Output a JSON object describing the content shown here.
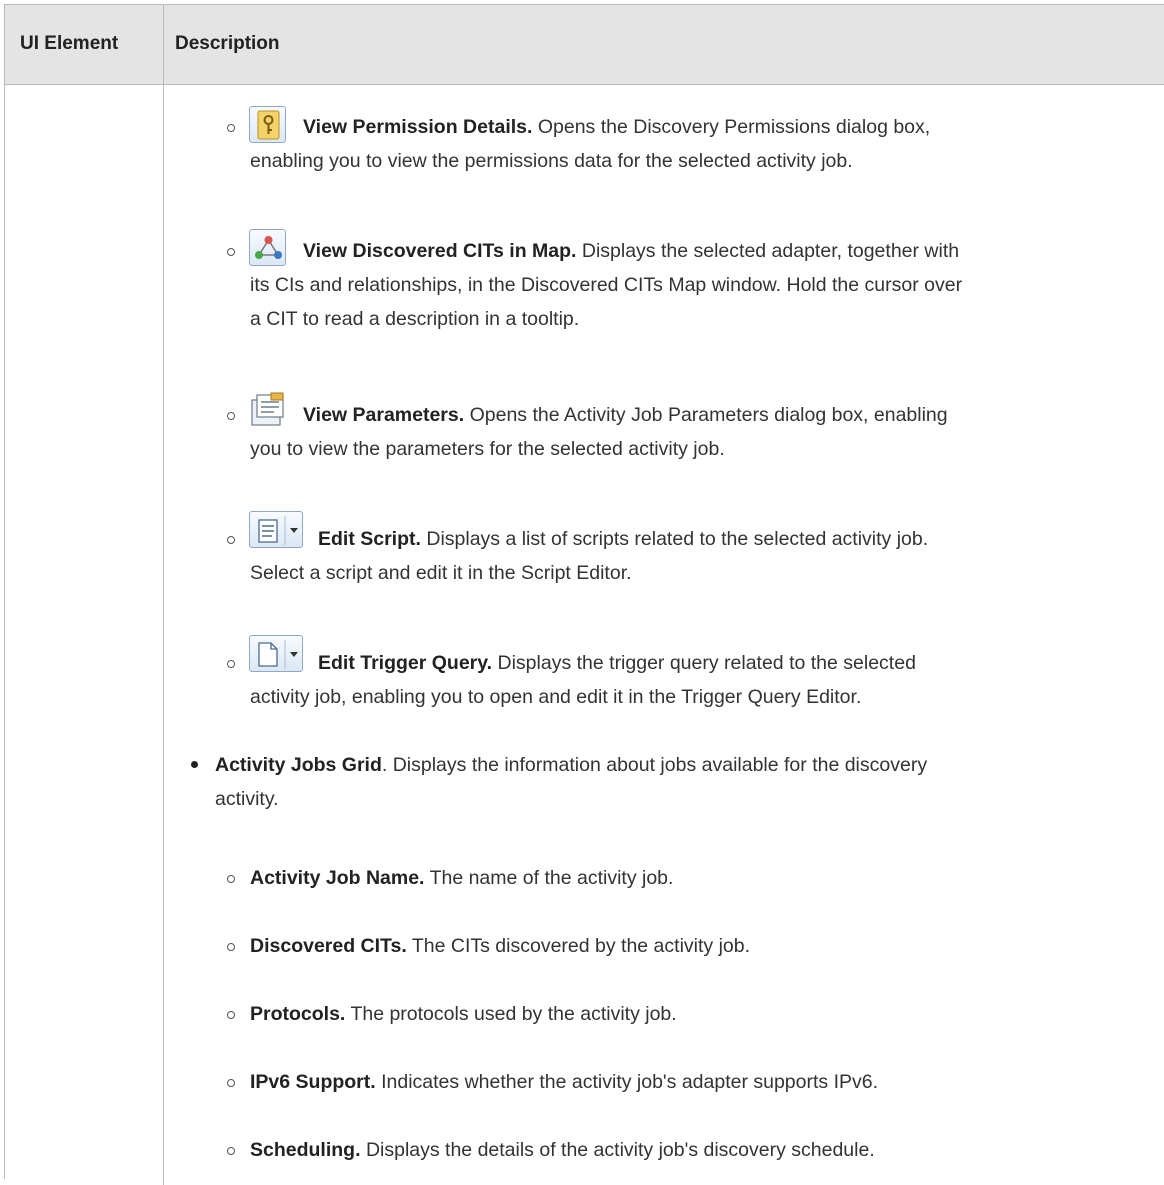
{
  "table": {
    "headers": [
      "UI Element",
      "Description"
    ]
  },
  "toolbar_items": [
    {
      "icon": "key-icon",
      "name": "View Permission Details.",
      "lines": [
        "Opens the Discovery Permissions dialog box,",
        "enabling you to view the permissions data for the selected activity job."
      ]
    },
    {
      "icon": "map-icon",
      "name": "View Discovered CITs in Map.",
      "lines": [
        "Displays the selected adapter, together with",
        "its CIs and relationships, in the Discovered CITs Map window. Hold the cursor over",
        "a CIT to read a description in a tooltip."
      ]
    },
    {
      "icon": "parameters-icon",
      "name": "View Parameters.",
      "lines": [
        "Opens the Activity Job Parameters dialog box, enabling",
        "you to view the parameters for the selected activity job."
      ]
    },
    {
      "icon": "edit-script-icon",
      "name": "Edit Script.",
      "lines": [
        "Displays a list of scripts related to the selected activity job.",
        "Select a script and edit it in the Script Editor."
      ]
    },
    {
      "icon": "edit-trigger-query-icon",
      "name": "Edit Trigger Query.",
      "lines": [
        "Displays the trigger query related to the selected",
        "activity job, enabling you to open and edit it in the Trigger Query Editor."
      ]
    }
  ],
  "grid_section": {
    "name": "Activity Jobs Grid",
    "lines": [
      ". Displays the information about jobs available for the discovery",
      "activity."
    ],
    "columns": [
      {
        "name": "Activity Job Name.",
        "desc": "The name of the activity job."
      },
      {
        "name": "Discovered CITs.",
        "desc": "The CITs discovered by the activity job."
      },
      {
        "name": "Protocols.",
        "desc": "The protocols used by the activity job."
      },
      {
        "name": "IPv6 Support.",
        "desc": "Indicates whether the activity job's adapter supports IPv6."
      },
      {
        "name": "Scheduling.",
        "desc": "Displays the details of the activity job's discovery schedule."
      }
    ]
  }
}
